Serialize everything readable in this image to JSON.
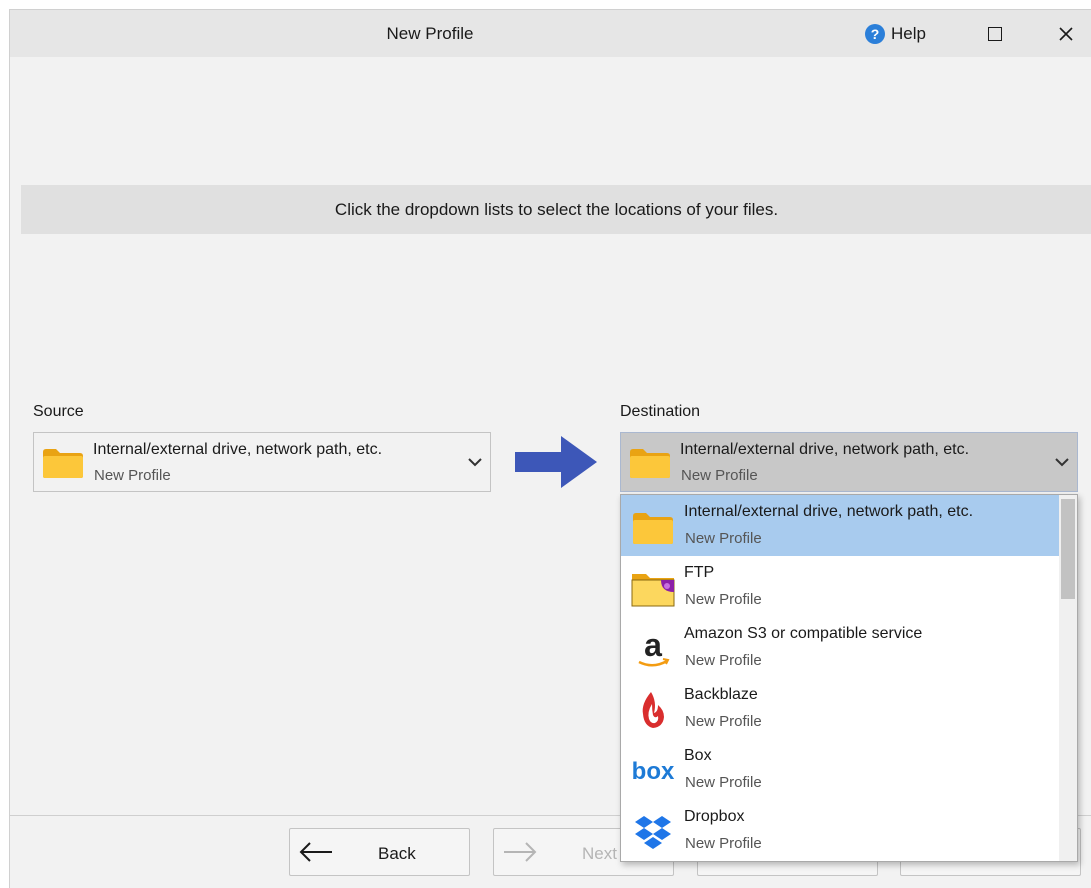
{
  "window": {
    "title": "New Profile",
    "help_label": "Help",
    "maximize_glyph": "□",
    "close_glyph": "✕"
  },
  "instruction": "Click the dropdown lists to select the locations of your files.",
  "source": {
    "label": "Source",
    "selected_title": "Internal/external drive, network path, etc.",
    "selected_sub": "New Profile",
    "icon": "folder-icon"
  },
  "destination": {
    "label": "Destination",
    "selected_title": "Internal/external drive, network path, etc.",
    "selected_sub": "New Profile",
    "icon": "folder-icon"
  },
  "dropdown": {
    "items": [
      {
        "title": "Internal/external drive, network path, etc.",
        "sub": "New Profile",
        "icon": "folder-icon",
        "selected": true
      },
      {
        "title": "FTP",
        "sub": "New Profile",
        "icon": "ftp-folder-icon",
        "selected": false
      },
      {
        "title": "Amazon S3 or compatible service",
        "sub": "New Profile",
        "icon": "amazon-icon",
        "selected": false
      },
      {
        "title": "Backblaze",
        "sub": "New Profile",
        "icon": "backblaze-icon",
        "selected": false
      },
      {
        "title": "Box",
        "sub": "New Profile",
        "icon": "box-icon",
        "selected": false
      },
      {
        "title": "Dropbox",
        "sub": "New Profile",
        "icon": "dropbox-icon",
        "selected": false
      }
    ]
  },
  "footer": {
    "back_label": "Back",
    "next_label": "Next"
  },
  "colors": {
    "accent_arrow": "#3d57b8",
    "selected_row": "#a8cbee",
    "folder": "#f9bb20",
    "help_icon": "#2b7fd9"
  }
}
